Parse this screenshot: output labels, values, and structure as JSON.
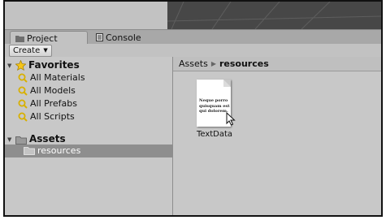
{
  "tabs": {
    "project_label": "Project",
    "console_label": "Console"
  },
  "toolbar": {
    "create_label": "Create",
    "create_caret": "▼"
  },
  "sidebar": {
    "favorites": {
      "label": "Favorites",
      "items": [
        {
          "label": "All Materials"
        },
        {
          "label": "All Models"
        },
        {
          "label": "All Prefabs"
        },
        {
          "label": "All Scripts"
        }
      ]
    },
    "assets": {
      "label": "Assets",
      "children": [
        {
          "label": "resources",
          "selected": true
        }
      ]
    }
  },
  "breadcrumb": {
    "root": "Assets",
    "separator": "▶",
    "current": "resources"
  },
  "assets_grid": {
    "items": [
      {
        "name": "TextData",
        "type": "text-asset",
        "preview_text": "Neque porro\nquisquam est\nqui dolorem."
      }
    ]
  },
  "colors": {
    "panel_bg": "#c8c8c8",
    "selection": "#8e8e8e",
    "favorites_star": "#f5c518",
    "folder": "#9a9a9a",
    "search_icon": "#d8b000"
  }
}
